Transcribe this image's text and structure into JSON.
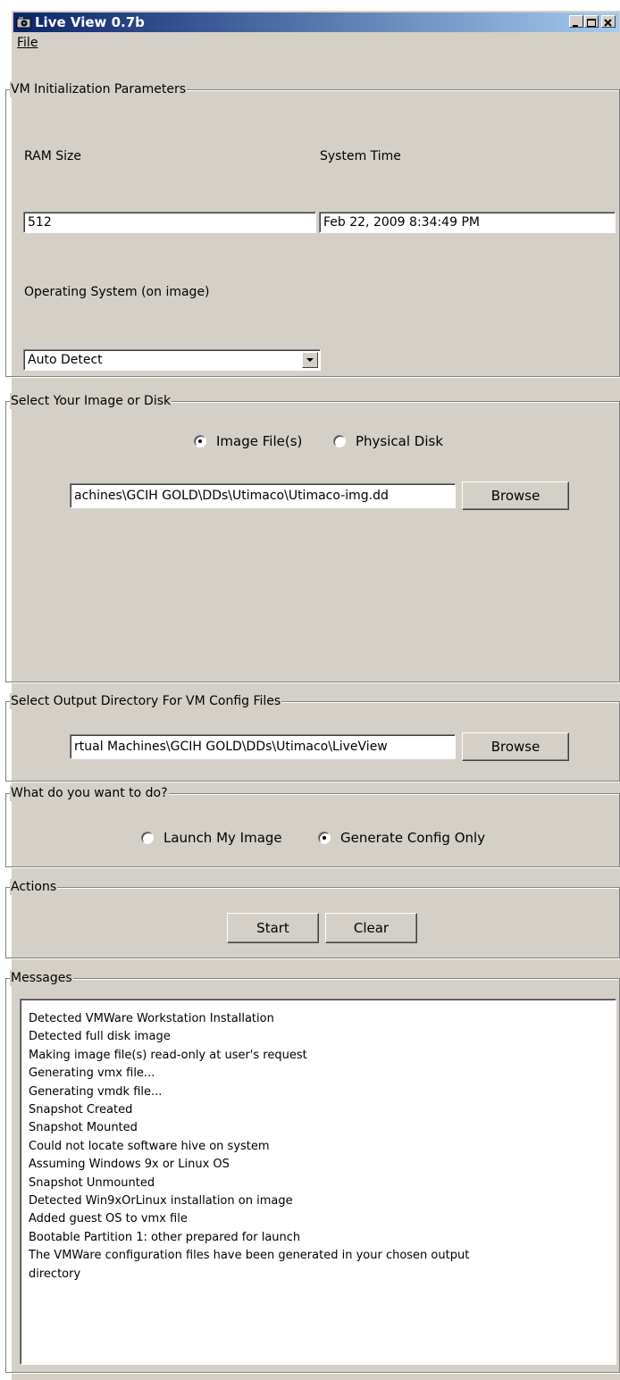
{
  "window": {
    "title": "Live View 0.7b",
    "app_icon": "camera-icon",
    "controls": [
      "minimize-icon",
      "maximize-icon",
      "close-icon"
    ]
  },
  "menu": {
    "file": "File"
  },
  "vm_params": {
    "group_label": "VM Initialization Parameters",
    "ram_label": "RAM Size",
    "ram_value": "512",
    "time_label": "System Time",
    "time_value": "Feb 22, 2009 8:34:49 PM",
    "os_label": "Operating System (on image)",
    "os_selected": "Auto Detect"
  },
  "image_select": {
    "group_label": "Select Your Image or Disk",
    "option_image": "Image File(s)",
    "option_disk": "Physical Disk",
    "selected": "image",
    "path_value": "achines\\GCIH GOLD\\DDs\\Utimaco\\Utimaco-img.dd",
    "browse": "Browse"
  },
  "output_dir": {
    "group_label": "Select Output Directory For VM Config Files",
    "path_value": "rtual Machines\\GCIH GOLD\\DDs\\Utimaco\\LiveView",
    "browse": "Browse"
  },
  "action_choice": {
    "group_label": "What do you want to do?",
    "option_launch": "Launch My Image",
    "option_config": "Generate Config Only",
    "selected": "config"
  },
  "actions": {
    "group_label": "Actions",
    "start": "Start",
    "clear": "Clear"
  },
  "messages": {
    "group_label": "Messages",
    "lines": [
      "Detected VMWare Workstation Installation",
      "Detected full disk image",
      "Making image file(s) read-only at user's request",
      "Generating vmx file...",
      "Generating vmdk file...",
      "Snapshot Created",
      "Snapshot Mounted",
      "Could not locate software hive on system",
      "Assuming Windows 9x or Linux OS",
      "Snapshot Unmounted",
      "Detected Win9xOrLinux installation on image",
      "Added guest OS to vmx file",
      "Bootable Partition 1: other prepared for launch",
      "The VMWare configuration files have been generated in your chosen output",
      "directory"
    ]
  }
}
